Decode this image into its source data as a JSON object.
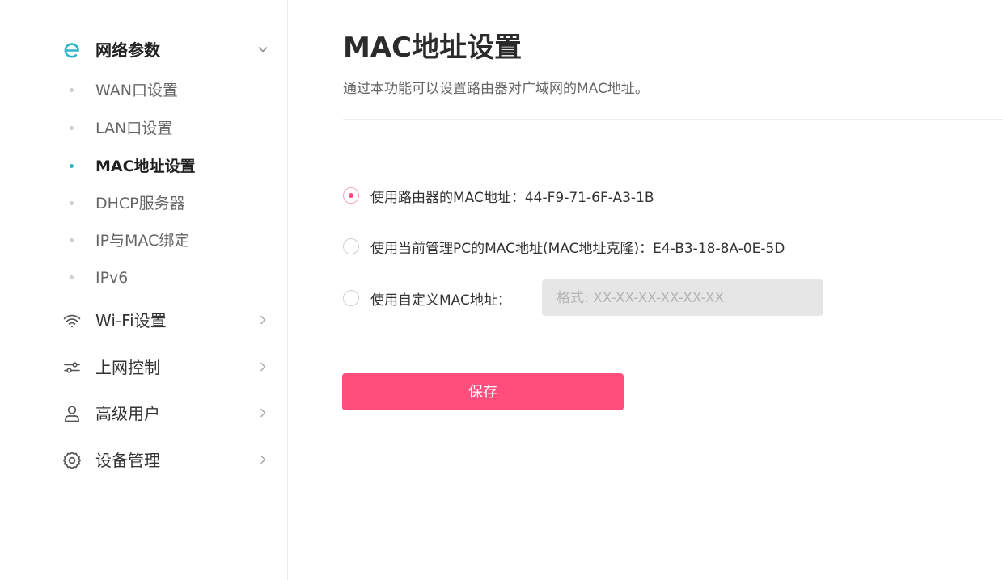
{
  "sidebar": {
    "network_params": {
      "label": "网络参数",
      "icon": "e-logo-icon",
      "expanded": true
    },
    "sub_items": [
      {
        "label": "WAN口设置",
        "active": false
      },
      {
        "label": "LAN口设置",
        "active": false
      },
      {
        "label": "MAC地址设置",
        "active": true
      },
      {
        "label": "DHCP服务器",
        "active": false
      },
      {
        "label": "IP与MAC绑定",
        "active": false
      },
      {
        "label": "IPv6",
        "active": false
      }
    ],
    "groups": [
      {
        "label": "Wi-Fi设置",
        "icon": "wifi-icon"
      },
      {
        "label": "上网控制",
        "icon": "sliders-icon"
      },
      {
        "label": "高级用户",
        "icon": "user-icon"
      },
      {
        "label": "设备管理",
        "icon": "gear-icon"
      }
    ]
  },
  "main": {
    "title": "MAC地址设置",
    "description": "通过本功能可以设置路由器对广域网的MAC地址。",
    "options": [
      {
        "label": "使用路由器的MAC地址：44-F9-71-6F-A3-1B",
        "checked": true
      },
      {
        "label": "使用当前管理PC的MAC地址(MAC地址克隆)：E4-B3-18-8A-0E-5D",
        "checked": false
      },
      {
        "label": "使用自定义MAC地址：",
        "checked": false
      }
    ],
    "custom_mac": {
      "value": "",
      "placeholder": "格式: XX-XX-XX-XX-XX-XX"
    },
    "save_label": "保存"
  },
  "colors": {
    "accent": "#ff4d7c",
    "active_dot": "#2cb6c8",
    "logo": "#2cb6c8"
  }
}
